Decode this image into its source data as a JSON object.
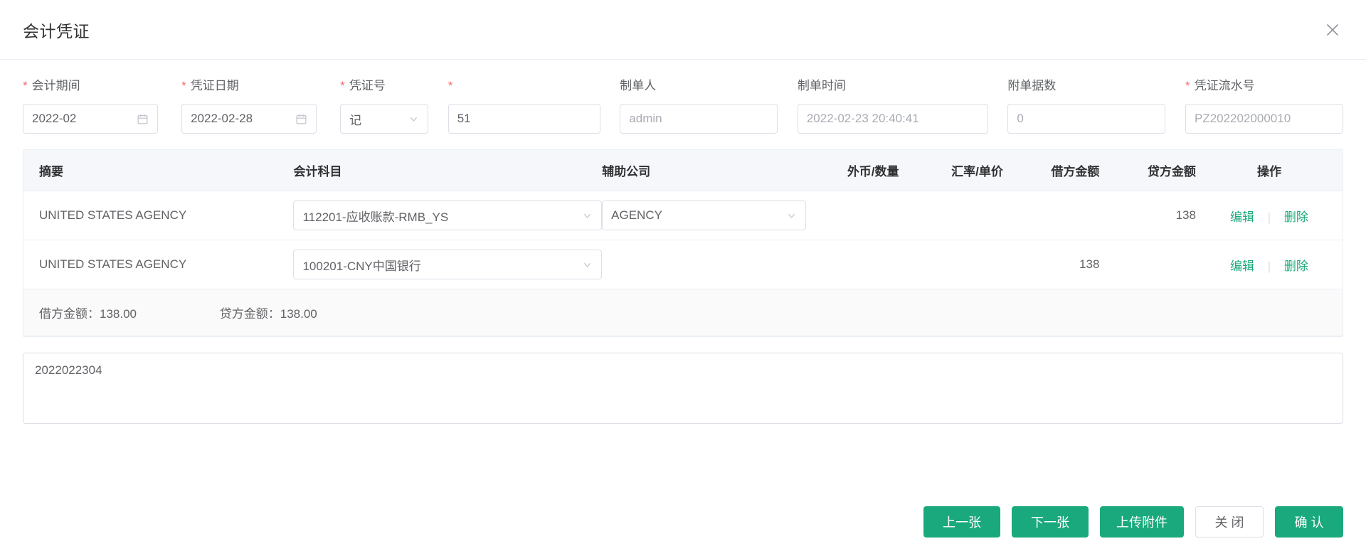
{
  "dialog": {
    "title": "会计凭证",
    "close_icon": "close-icon"
  },
  "form": {
    "fields": [
      {
        "label": "会计期间",
        "required": true,
        "value": "2022-02",
        "suffix": "calendar-icon",
        "disabled": false
      },
      {
        "label": "凭证日期",
        "required": true,
        "value": "2022-02-28",
        "suffix": "calendar-icon",
        "disabled": false
      },
      {
        "label": "凭证号",
        "required": true,
        "value": "记",
        "suffix": "chevron-down-icon",
        "disabled": false
      },
      {
        "label": "",
        "required": true,
        "value": "51",
        "suffix": "",
        "disabled": false
      },
      {
        "label": "制单人",
        "required": false,
        "value": "admin",
        "suffix": "",
        "disabled": true
      },
      {
        "label": "制单时间",
        "required": false,
        "value": "2022-02-23 20:40:41",
        "suffix": "",
        "disabled": true
      },
      {
        "label": "附单据数",
        "required": false,
        "value": "0",
        "suffix": "",
        "disabled": true
      },
      {
        "label": "凭证流水号",
        "required": true,
        "value": "PZ202202000010",
        "suffix": "",
        "disabled": true
      }
    ]
  },
  "table": {
    "columns": [
      "摘要",
      "会计科目",
      "辅助公司",
      "外币/数量",
      "汇率/单价",
      "借方金额",
      "贷方金额",
      "操作"
    ],
    "rows": [
      {
        "summary": "UNITED STATES AGENCY",
        "account": "112201-应收账款-RMB_YS",
        "aux": "AGENCY",
        "fx": "",
        "rate": "",
        "debit": "",
        "credit": "138",
        "edit_label": "编辑",
        "delete_label": "删除"
      },
      {
        "summary": "UNITED STATES AGENCY",
        "account": "100201-CNY中国银行",
        "aux": "",
        "fx": "",
        "rate": "",
        "debit": "138",
        "credit": "",
        "edit_label": "编辑",
        "delete_label": "删除"
      }
    ],
    "totals": {
      "debit_label": "借方金额：138.00",
      "credit_label": "贷方金额：138.00"
    }
  },
  "note": {
    "value": "2022022304",
    "placeholder": ""
  },
  "footer": {
    "prev_label": "上一张",
    "next_label": "下一张",
    "upload_label": "上传附件",
    "close_label": "关 闭",
    "confirm_label": "确 认"
  },
  "colors": {
    "accent_green": "#1aa97c",
    "required_red": "#f56c6c",
    "border": "#dcdfe6",
    "header_bg": "#f5f7fa"
  }
}
